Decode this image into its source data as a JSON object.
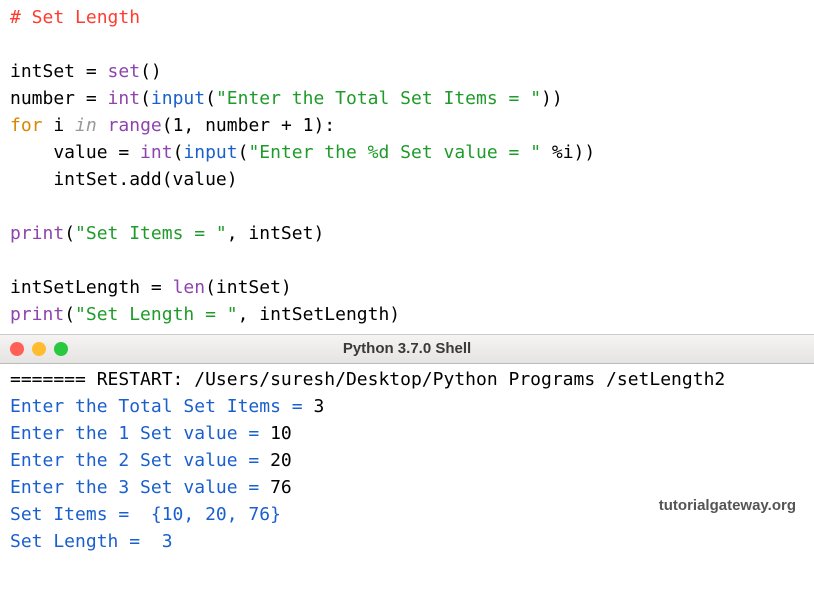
{
  "code": {
    "comment": "# Set Length",
    "l1_a": "intSet = ",
    "l1_b": "set",
    "l1_c": "()",
    "l2_a": "number = ",
    "l2_b": "int",
    "l2_c": "(",
    "l2_d": "input",
    "l2_e": "(",
    "l2_f": "\"Enter the Total Set Items = \"",
    "l2_g": "))",
    "l3_a": "for",
    "l3_b": " i ",
    "l3_c": "in",
    "l3_d": " ",
    "l3_e": "range",
    "l3_f": "(1, number + 1):",
    "l4_a": "    value = ",
    "l4_b": "int",
    "l4_c": "(",
    "l4_d": "input",
    "l4_e": "(",
    "l4_f": "\"Enter the %d Set value = \"",
    "l4_g": " %i))",
    "l5": "    intSet.add(value)",
    "l6_a": "print",
    "l6_b": "(",
    "l6_c": "\"Set Items = \"",
    "l6_d": ", intSet)",
    "l7_a": "intSetLength = ",
    "l7_b": "len",
    "l7_c": "(intSet)",
    "l8_a": "print",
    "l8_b": "(",
    "l8_c": "\"Set Length = \"",
    "l8_d": ", intSetLength)"
  },
  "shell": {
    "title": "Python 3.7.0 Shell",
    "restart_prefix": "=======",
    "restart_text": " RESTART: /Users/suresh/Desktop/Python Programs /setLength2",
    "p1": "Enter the Total Set Items = ",
    "v1": "3",
    "p2": "Enter the 1 Set value = ",
    "v2": "10",
    "p3": "Enter the 2 Set value = ",
    "v3": "20",
    "p4": "Enter the 3 Set value = ",
    "v4": "76",
    "o1": "Set Items =  {10, 20, 76}",
    "o2": "Set Length =  3"
  },
  "watermark": "tutorialgateway.org"
}
